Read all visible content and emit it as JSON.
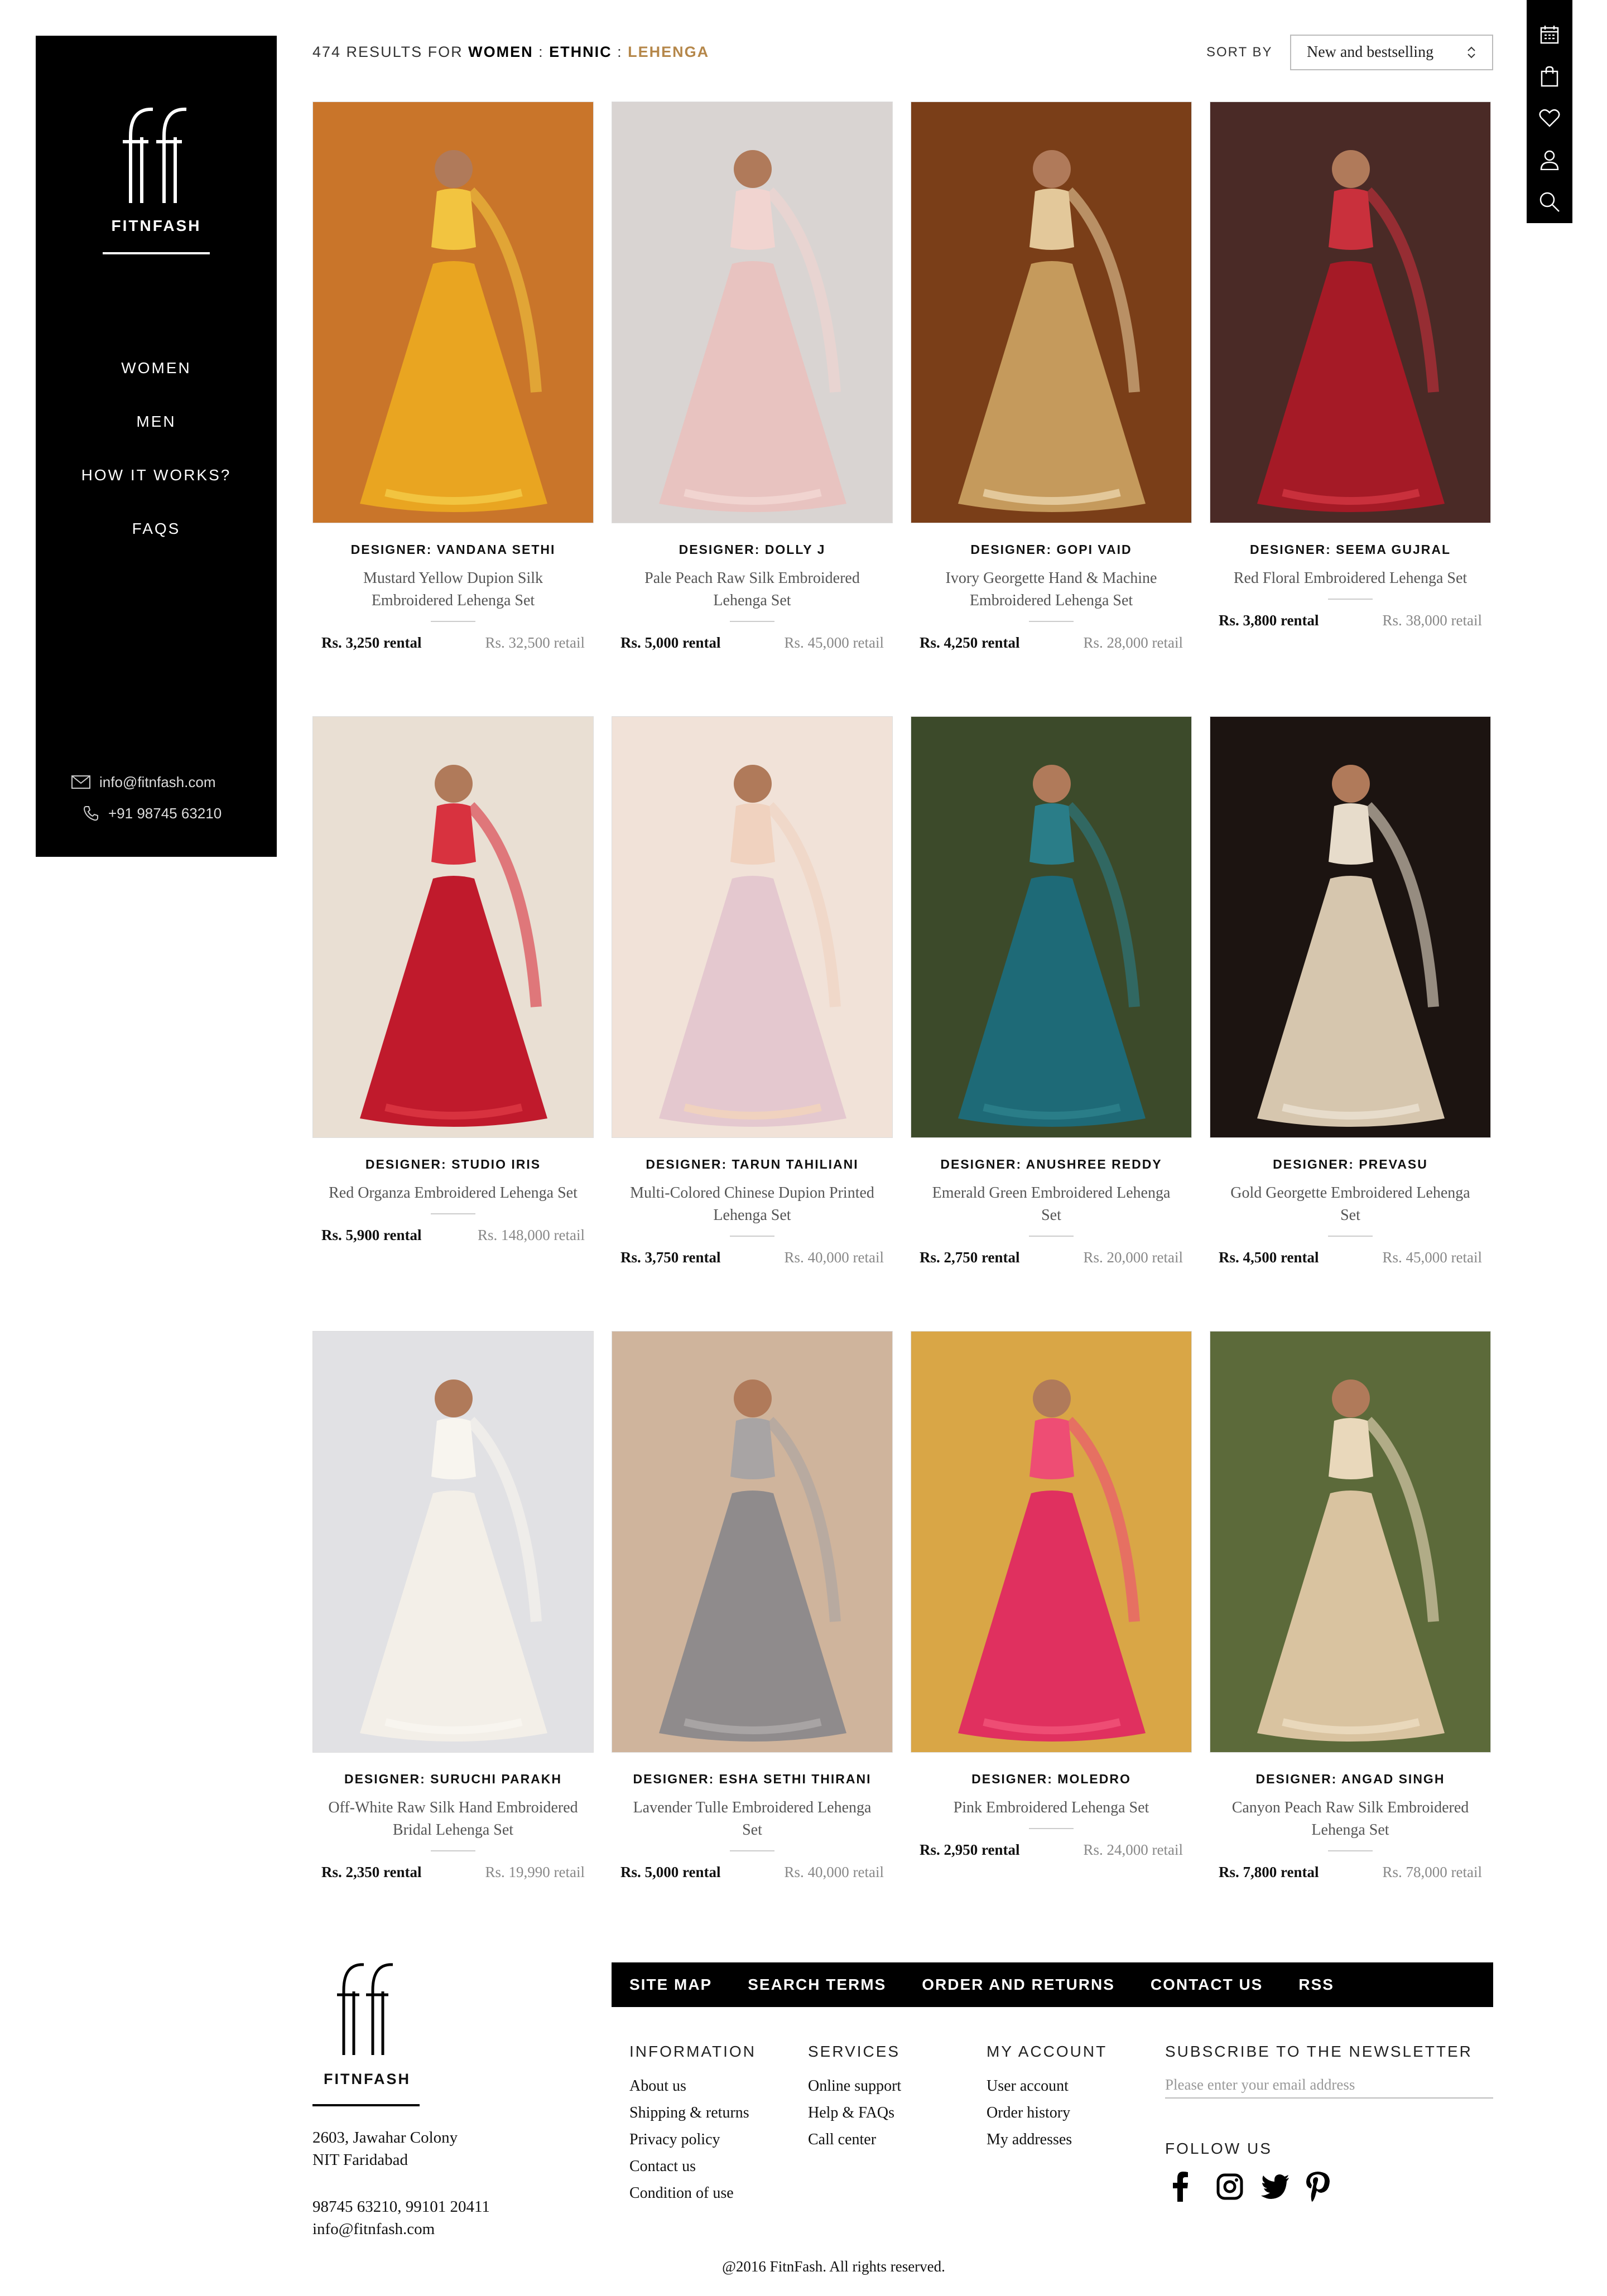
{
  "brand": {
    "name": "FITNFASH"
  },
  "sidebar": {
    "nav": [
      "WOMEN",
      "MEN",
      "HOW IT WORKS?",
      "FAQS"
    ],
    "email": "info@fitnfash.com",
    "phone": "+91 98745 63210"
  },
  "results": {
    "count_text": "474 RESULTS FOR",
    "crumb1": "WOMEN",
    "sep": ":",
    "crumb2": "ETHNIC",
    "crumb3": "LEHENGA"
  },
  "sort": {
    "label": "SORT BY",
    "value": "New and bestselling"
  },
  "products": [
    {
      "designer": "DESIGNER: VANDANA SETHI",
      "name": "Mustard Yellow Dupion Silk Embroidered Lehenga Set",
      "rental": "Rs. 3,250 rental",
      "retail": "Rs. 32,500 retail",
      "colors": [
        "#c9752a",
        "#e9a521",
        "#f2c440"
      ]
    },
    {
      "designer": "DESIGNER: DOLLY J",
      "name": "Pale Peach Raw Silk Embroidered Lehenga Set",
      "rental": "Rs. 5,000 rental",
      "retail": "Rs. 45,000 retail",
      "colors": [
        "#d9d4d2",
        "#e8c3c0",
        "#f1d4d0"
      ]
    },
    {
      "designer": "DESIGNER: GOPI VAID",
      "name": "Ivory Georgette Hand & Machine Embroidered Lehenga Set",
      "rental": "Rs. 4,250 rental",
      "retail": "Rs. 28,000 retail",
      "colors": [
        "#7a3e18",
        "#c59a5c",
        "#e3c89a"
      ]
    },
    {
      "designer": "DESIGNER: SEEMA GUJRAL",
      "name": "Red Floral Embroidered Lehenga Set",
      "rental": "Rs. 3,800 rental",
      "retail": "Rs. 38,000 retail",
      "colors": [
        "#4a2a26",
        "#a51a26",
        "#c9303c"
      ]
    },
    {
      "designer": "DESIGNER: STUDIO IRIS",
      "name": "Red Organza Embroidered Lehenga Set",
      "rental": "Rs. 5,900 rental",
      "retail": "Rs. 148,000 retail",
      "colors": [
        "#e9dfd3",
        "#c01a2c",
        "#d8323f"
      ]
    },
    {
      "designer": "DESIGNER: TARUN TAHILIANI",
      "name": "Multi-Colored Chinese Dupion Printed Lehenga Set",
      "rental": "Rs. 3,750 rental",
      "retail": "Rs. 40,000 retail",
      "colors": [
        "#f1e2d8",
        "#e4c8cf",
        "#f0d2bf"
      ]
    },
    {
      "designer": "DESIGNER: ANUSHREE REDDY",
      "name": "Emerald Green Embroidered Lehenga Set",
      "rental": "Rs. 2,750 rental",
      "retail": "Rs. 20,000 retail",
      "colors": [
        "#3c4a2a",
        "#1e6a77",
        "#2a7d88"
      ]
    },
    {
      "designer": "DESIGNER: PREVASU",
      "name": "Gold Georgette Embroidered Lehenga Set",
      "rental": "Rs. 4,500 rental",
      "retail": "Rs. 45,000 retail",
      "colors": [
        "#1c1411",
        "#d6c6ae",
        "#e7dccb"
      ]
    },
    {
      "designer": "DESIGNER: SURUCHI PARAKH",
      "name": "Off-White Raw Silk Hand Embroidered Bridal Lehenga Set",
      "rental": "Rs. 2,350 rental",
      "retail": "Rs. 19,990 retail",
      "colors": [
        "#e1e1e4",
        "#f3efe8",
        "#f8f5ef"
      ]
    },
    {
      "designer": "DESIGNER: ESHA SETHI THIRANI",
      "name": "Lavender Tulle Embroidered Lehenga Set",
      "rental": "Rs. 5,000 rental",
      "retail": "Rs. 40,000 retail",
      "colors": [
        "#cfb49c",
        "#8f8b8c",
        "#a8a4a4"
      ]
    },
    {
      "designer": "DESIGNER: MOLEDRO",
      "name": "Pink Embroidered Lehenga Set",
      "rental": "Rs. 2,950 rental",
      "retail": "Rs. 24,000 retail",
      "colors": [
        "#d9a646",
        "#e0305f",
        "#ee4d74"
      ]
    },
    {
      "designer": "DESIGNER: ANGAD SINGH",
      "name": "Canyon Peach Raw Silk Embroidered Lehenga Set",
      "rental": "Rs. 7,800 rental",
      "retail": "Rs. 78,000 retail",
      "colors": [
        "#5c6a3a",
        "#d9c3a0",
        "#e9d8bb"
      ]
    }
  ],
  "footer": {
    "links": [
      "SITE MAP",
      "SEARCH TERMS",
      "ORDER AND RETURNS",
      "CONTACT US",
      "RSS"
    ],
    "address1": "2603, Jawahar Colony",
    "address2": "NIT Faridabad",
    "phones": "98745 63210, 99101 20411",
    "email": "info@fitnfash.com",
    "information": {
      "title": "INFORMATION",
      "items": [
        "About us",
        "Shipping & returns",
        "Privacy policy",
        "Contact us",
        "Condition of use"
      ]
    },
    "services": {
      "title": "SERVICES",
      "items": [
        "Online support",
        "Help & FAQs",
        "Call center"
      ]
    },
    "account": {
      "title": "MY ACCOUNT",
      "items": [
        "User account",
        "Order history",
        "My addresses"
      ]
    },
    "newsletter": {
      "title": "SUBSCRIBE TO THE NEWSLETTER",
      "placeholder": "Please enter your email address"
    },
    "follow": "FOLLOW US",
    "copyright": "@2016 FitnFash. All rights reserved."
  }
}
